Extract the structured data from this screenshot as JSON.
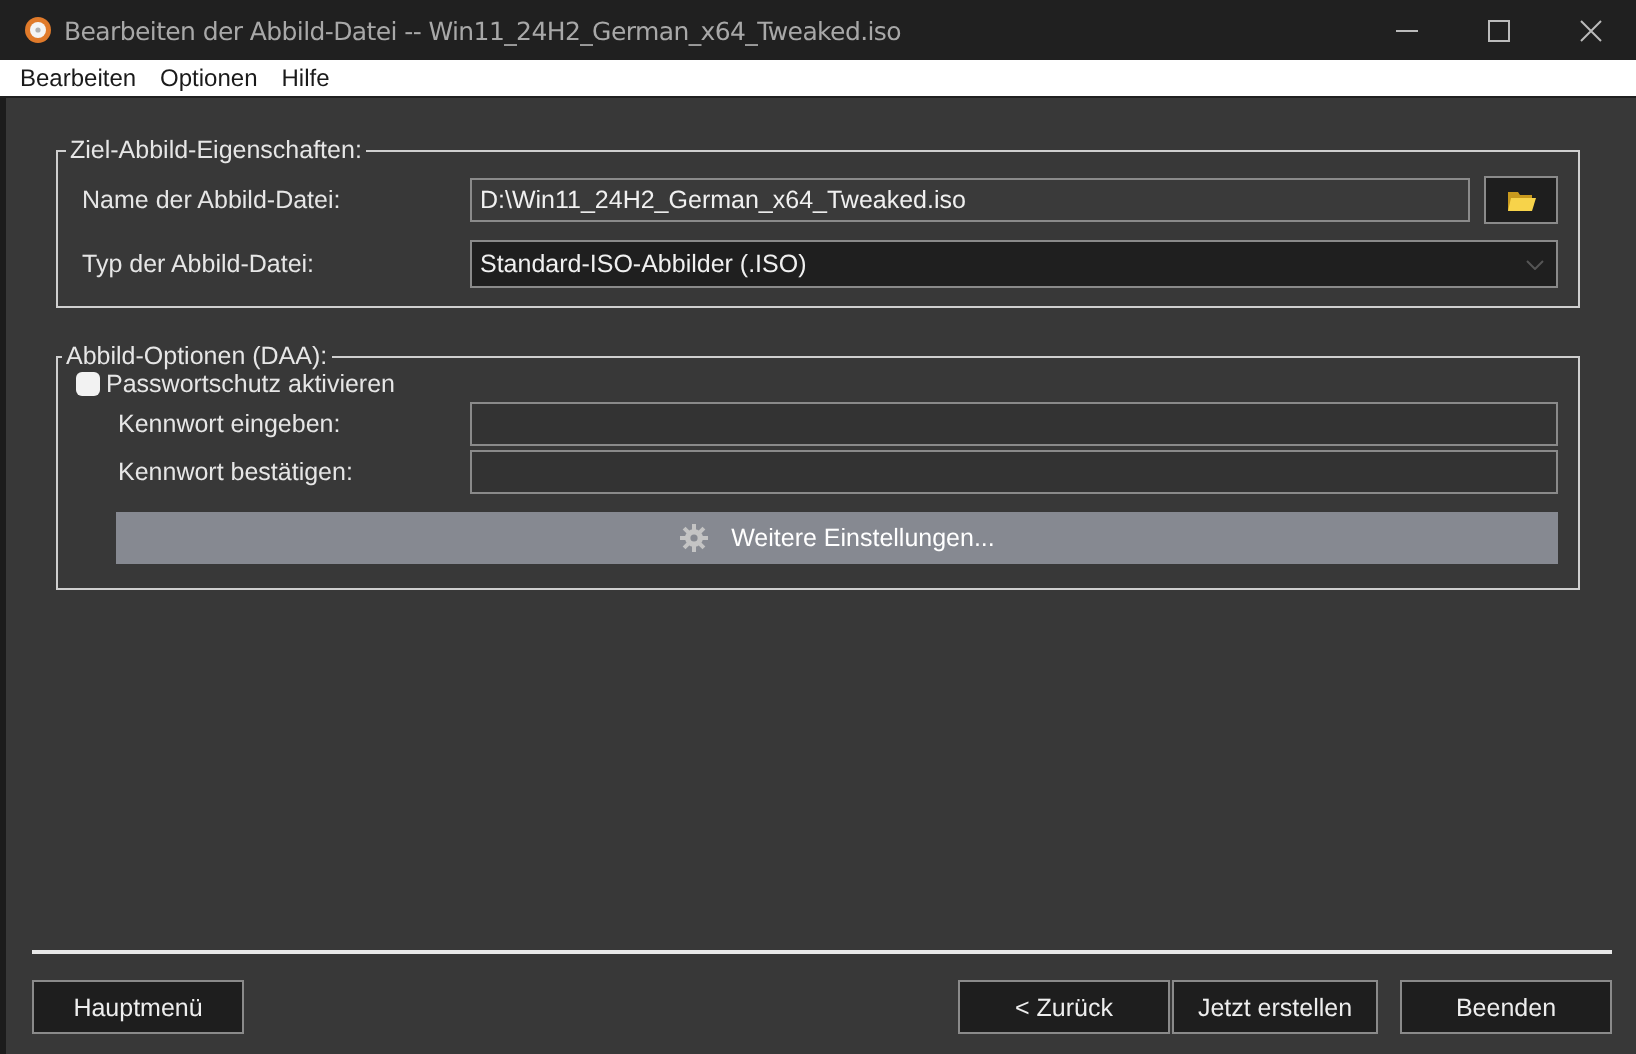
{
  "window": {
    "title": "Bearbeiten der Abbild-Datei -- Win11_24H2_German_x64_Tweaked.iso"
  },
  "menu": [
    "Bearbeiten",
    "Optionen",
    "Hilfe"
  ],
  "target_group": {
    "title": "Ziel-Abbild-Eigenschaften:",
    "name_label": "Name der Abbild-Datei:",
    "name_value": "D:\\Win11_24H2_German_x64_Tweaked.iso",
    "type_label": "Typ der Abbild-Datei:",
    "type_value": "Standard-ISO-Abbilder (.ISO)"
  },
  "options_group": {
    "title": "Abbild-Optionen (DAA):",
    "password_protection": {
      "label": "Passwortschutz aktivieren",
      "checked": false
    },
    "password_fields": [
      {
        "label": "Kennwort eingeben:"
      },
      {
        "label": "Kennwort bestätigen:"
      }
    ],
    "more_settings_button": "Weitere Einstellungen..."
  },
  "footer_buttons": [
    [
      "Hauptmenü"
    ],
    [
      "< Zurück",
      "Jetzt erstellen"
    ],
    [
      "Beenden"
    ]
  ]
}
